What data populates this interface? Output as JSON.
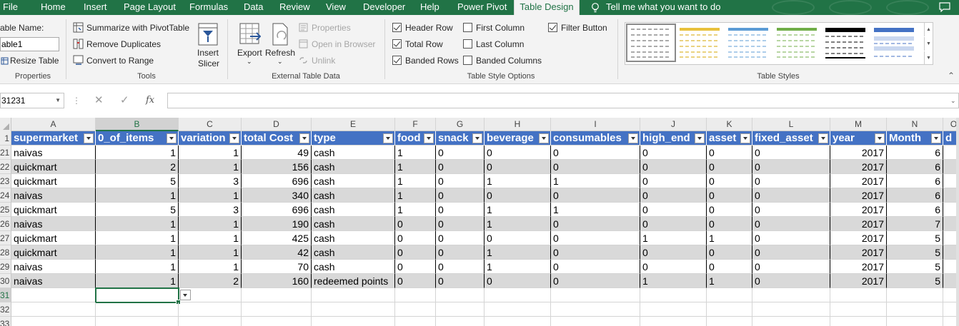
{
  "tabs": [
    "File",
    "Home",
    "Insert",
    "Page Layout",
    "Formulas",
    "Data",
    "Review",
    "View",
    "Developer",
    "Help",
    "Power Pivot",
    "Table Design"
  ],
  "active_tab": "Table Design",
  "tell_me": "Tell me what you want to do",
  "ribbon": {
    "properties": {
      "table_name_label": "able Name:",
      "table_name_value": "able1",
      "resize_table": "Resize Table",
      "group_label": "Properties"
    },
    "tools": {
      "summarize": "Summarize with PivotTable",
      "remove_duplicates": "Remove Duplicates",
      "convert_to_range": "Convert to Range",
      "insert_slicer_1": "Insert",
      "insert_slicer_2": "Slicer",
      "group_label": "Tools"
    },
    "external": {
      "export": "Export",
      "refresh": "Refresh",
      "properties": "Properties",
      "open_in_browser": "Open in Browser",
      "unlink": "Unlink",
      "group_label": "External Table Data"
    },
    "style_options": {
      "header_row": "Header Row",
      "total_row": "Total Row",
      "banded_rows": "Banded Rows",
      "first_column": "First Column",
      "last_column": "Last Column",
      "banded_columns": "Banded Columns",
      "filter_button": "Filter Button",
      "group_label": "Table Style Options",
      "checked": {
        "header_row": true,
        "total_row": true,
        "banded_rows": true,
        "first_column": false,
        "last_column": false,
        "banded_columns": false,
        "filter_button": true
      }
    },
    "table_styles": {
      "group_label": "Table Styles"
    }
  },
  "formula_bar": {
    "name_box": "31231",
    "formula": ""
  },
  "colors": {
    "excel_green": "#217346",
    "table_header": "#4472c4",
    "band": "#d9d9d9"
  },
  "columns": [
    "A",
    "B",
    "C",
    "D",
    "E",
    "F",
    "G",
    "H",
    "I",
    "J",
    "K",
    "L",
    "M",
    "N",
    "O"
  ],
  "selected_column": "B",
  "header_row_number": "1",
  "table_headers": [
    "supermarket",
    "0_of_items",
    "variation",
    "total Cost",
    "type",
    "food",
    "snack",
    "beverage",
    "consumables",
    "high_end",
    "asset",
    "fixed_asset",
    "year",
    "Month",
    "d"
  ],
  "rows": [
    {
      "num": "21",
      "cells": [
        "naivas",
        "1",
        "1",
        "49",
        "cash",
        "1",
        "0",
        "0",
        "0",
        "0",
        "0",
        "0",
        "2017",
        "6"
      ]
    },
    {
      "num": "22",
      "cells": [
        "quickmart",
        "2",
        "1",
        "156",
        "cash",
        "1",
        "0",
        "0",
        "0",
        "0",
        "0",
        "0",
        "2017",
        "6"
      ]
    },
    {
      "num": "23",
      "cells": [
        "quickmart",
        "5",
        "3",
        "696",
        "cash",
        "1",
        "0",
        "1",
        "1",
        "0",
        "0",
        "0",
        "2017",
        "6"
      ]
    },
    {
      "num": "24",
      "cells": [
        "naivas",
        "1",
        "1",
        "340",
        "cash",
        "1",
        "0",
        "0",
        "0",
        "0",
        "0",
        "0",
        "2017",
        "6"
      ]
    },
    {
      "num": "25",
      "cells": [
        "quickmart",
        "5",
        "3",
        "696",
        "cash",
        "1",
        "0",
        "1",
        "1",
        "0",
        "0",
        "0",
        "2017",
        "6"
      ]
    },
    {
      "num": "26",
      "cells": [
        "naivas",
        "1",
        "1",
        "190",
        "cash",
        "0",
        "0",
        "1",
        "0",
        "0",
        "0",
        "0",
        "2017",
        "7"
      ]
    },
    {
      "num": "27",
      "cells": [
        "quickmart",
        "1",
        "1",
        "425",
        "cash",
        "0",
        "0",
        "0",
        "0",
        "1",
        "1",
        "0",
        "2017",
        "5"
      ]
    },
    {
      "num": "28",
      "cells": [
        "quickmart",
        "1",
        "1",
        "42",
        "cash",
        "0",
        "0",
        "1",
        "0",
        "0",
        "0",
        "0",
        "2017",
        "5"
      ]
    },
    {
      "num": "29",
      "cells": [
        "naivas",
        "1",
        "1",
        "70",
        "cash",
        "0",
        "0",
        "1",
        "0",
        "0",
        "0",
        "0",
        "2017",
        "5"
      ]
    },
    {
      "num": "30",
      "cells": [
        "naivas",
        "1",
        "2",
        "160",
        "redeemed points",
        "0",
        "0",
        "0",
        "0",
        "1",
        "1",
        "0",
        "2017",
        "5"
      ]
    }
  ],
  "blank_rows": [
    "31",
    "32",
    "33"
  ],
  "active_row": "31"
}
